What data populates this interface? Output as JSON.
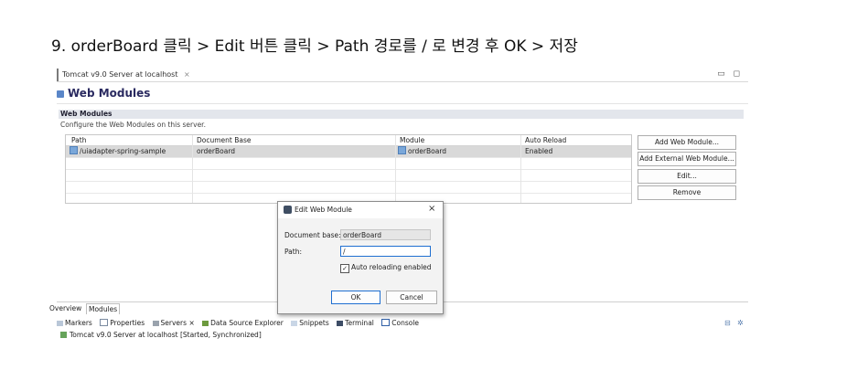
{
  "instruction": "9.  orderBoard 클릭 > Edit 버튼 클릭 > Path 경로를 / 로 변경 후 OK > 저장",
  "editor": {
    "tab_label": "Tomcat v9.0 Server at localhost",
    "tab_close": "×",
    "window_controls": "▭ ◻",
    "title": "Web Modules"
  },
  "section": {
    "heading": "Web Modules",
    "description": "Configure the Web Modules on this server."
  },
  "table": {
    "columns": [
      "Path",
      "Document Base",
      "Module",
      "Auto Reload"
    ],
    "rows": [
      {
        "path": "/uiadapter-spring-sample",
        "document_base": "orderBoard",
        "module": "orderBoard",
        "auto_reload": "Enabled"
      }
    ]
  },
  "buttons": {
    "add_module": "Add Web Module...",
    "add_external": "Add External Web Module...",
    "edit": "Edit...",
    "remove": "Remove"
  },
  "bottom_tabs": {
    "overview": "Overview",
    "modules": "Modules"
  },
  "views": {
    "markers": "Markers",
    "properties": "Properties",
    "servers": "Servers",
    "servers_close": "×",
    "data_source": "Data Source Explorer",
    "snippets": "Snippets",
    "terminal": "Terminal",
    "console": "Console"
  },
  "server_entry": "Tomcat v9.0 Server at localhost  [Started, Synchronized]",
  "dialog": {
    "title": "Edit Web Module",
    "close": "×",
    "document_base_label": "Document base:",
    "document_base_value": "orderBoard",
    "path_label": "Path:",
    "path_value": "/",
    "auto_reload_label": "Auto reloading enabled",
    "auto_reload_checked": "✓",
    "ok": "OK",
    "cancel": "Cancel"
  }
}
